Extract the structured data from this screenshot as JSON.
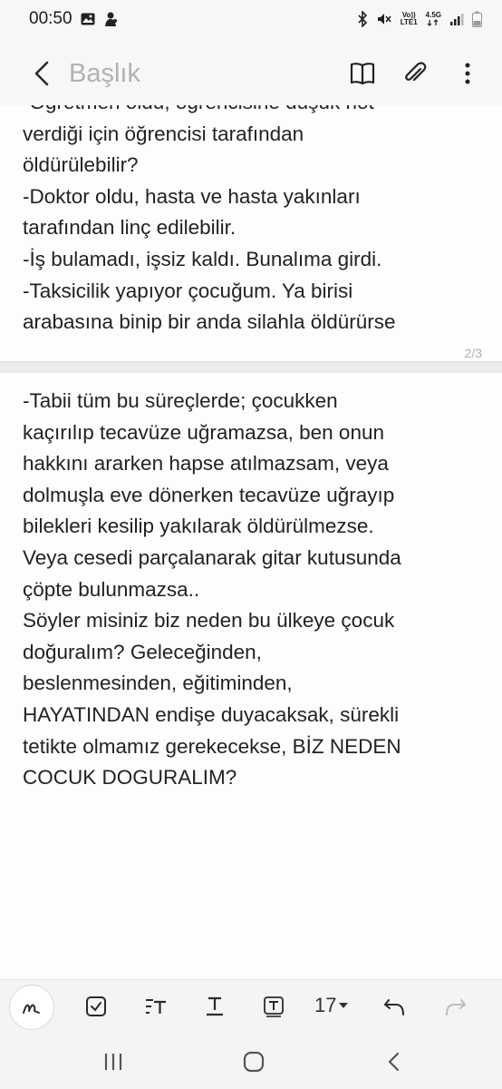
{
  "status_bar": {
    "time": "00:50",
    "volte_label": "Vo))\nLTE1",
    "network_label": "4.5G"
  },
  "app_bar": {
    "title_placeholder": "Başlık"
  },
  "note": {
    "page1_text": "-Öğretmen oldu, öğrencisine düşük not\nverdiği için öğrencisi tarafından\nöldürülebilir?\n-Doktor oldu, hasta ve hasta yakınları\ntarafından linç edilebilir.\n-İş bulamadı, işsiz kaldı. Bunalıma girdi.\n-Taksicilik yapıyor çocuğum. Ya birisi\narabasına binip bir anda silahla öldürürse",
    "page_indicator": "2/3",
    "page2_text": "-Tabii tüm bu süreçlerde; çocukken\nkaçırılıp tecavüze uğramazsa, ben onun\nhakkını ararken hapse atılmazsam, veya\ndolmuşla eve dönerken tecavüze uğrayıp\nbilekleri kesilip yakılarak öldürülmezse.\nVeya cesedi parçalanarak gitar kutusunda\nçöpte bulunmazsa..\nSöyler misiniz biz neden bu ülkeye çocuk\ndoğuralım? Geleceğinden,\nbeslenmesinden, eğitiminden,\nHAYATINDAN endişe duyacaksak, sürekli\ntetikte olmamız gerekecekse, BİZ NEDEN\nCOCUK DOGURALIM?"
  },
  "toolbar": {
    "font_size": "17"
  },
  "colors": {
    "background": "#f7f7f7",
    "page": "#fdfdfd",
    "text": "#222222",
    "placeholder": "#b2b2b2"
  }
}
